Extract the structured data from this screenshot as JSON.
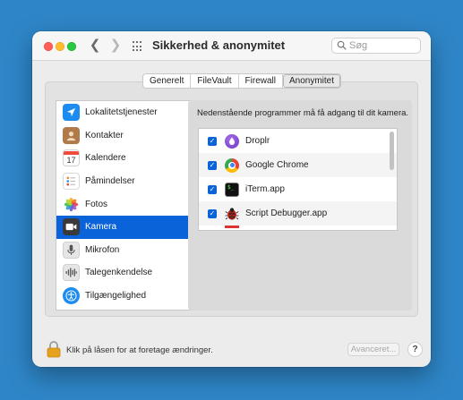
{
  "window": {
    "title": "Sikkerhed & anonymitet",
    "search_placeholder": "Søg"
  },
  "tabs": [
    {
      "label": "Generelt",
      "active": false
    },
    {
      "label": "FileVault",
      "active": false
    },
    {
      "label": "Firewall",
      "active": false
    },
    {
      "label": "Anonymitet",
      "active": true
    }
  ],
  "sidebar": {
    "selected": "Kamera",
    "items": [
      {
        "label": "Lokalitetstjenester",
        "icon": "location-arrow-icon"
      },
      {
        "label": "Kontakter",
        "icon": "contacts-icon"
      },
      {
        "label": "Kalendere",
        "icon": "calendar-icon",
        "icon_text": "17"
      },
      {
        "label": "Påmindelser",
        "icon": "reminders-icon"
      },
      {
        "label": "Fotos",
        "icon": "photos-icon"
      },
      {
        "label": "Kamera",
        "icon": "camera-icon"
      },
      {
        "label": "Mikrofon",
        "icon": "microphone-icon"
      },
      {
        "label": "Talegenkendelse",
        "icon": "waveform-icon"
      },
      {
        "label": "Tilgængelighed",
        "icon": "accessibility-icon"
      }
    ]
  },
  "main": {
    "description": "Nedenstående programmer må få adgang til dit kamera.",
    "apps": [
      {
        "name": "Droplr",
        "checked": true,
        "icon": "droplr-icon"
      },
      {
        "name": "Google Chrome",
        "checked": true,
        "icon": "chrome-icon"
      },
      {
        "name": "iTerm.app",
        "checked": true,
        "icon": "iterm-icon"
      },
      {
        "name": "Script Debugger.app",
        "checked": true,
        "icon": "script-debugger-icon"
      }
    ]
  },
  "footer": {
    "lock_text": "Klik på låsen for at foretage ændringer.",
    "advanced_label": "Avanceret...",
    "help_label": "?"
  },
  "colors": {
    "desktop": "#2e86c8",
    "selection": "#0a63d8",
    "checkbox": "#0a63d8"
  }
}
